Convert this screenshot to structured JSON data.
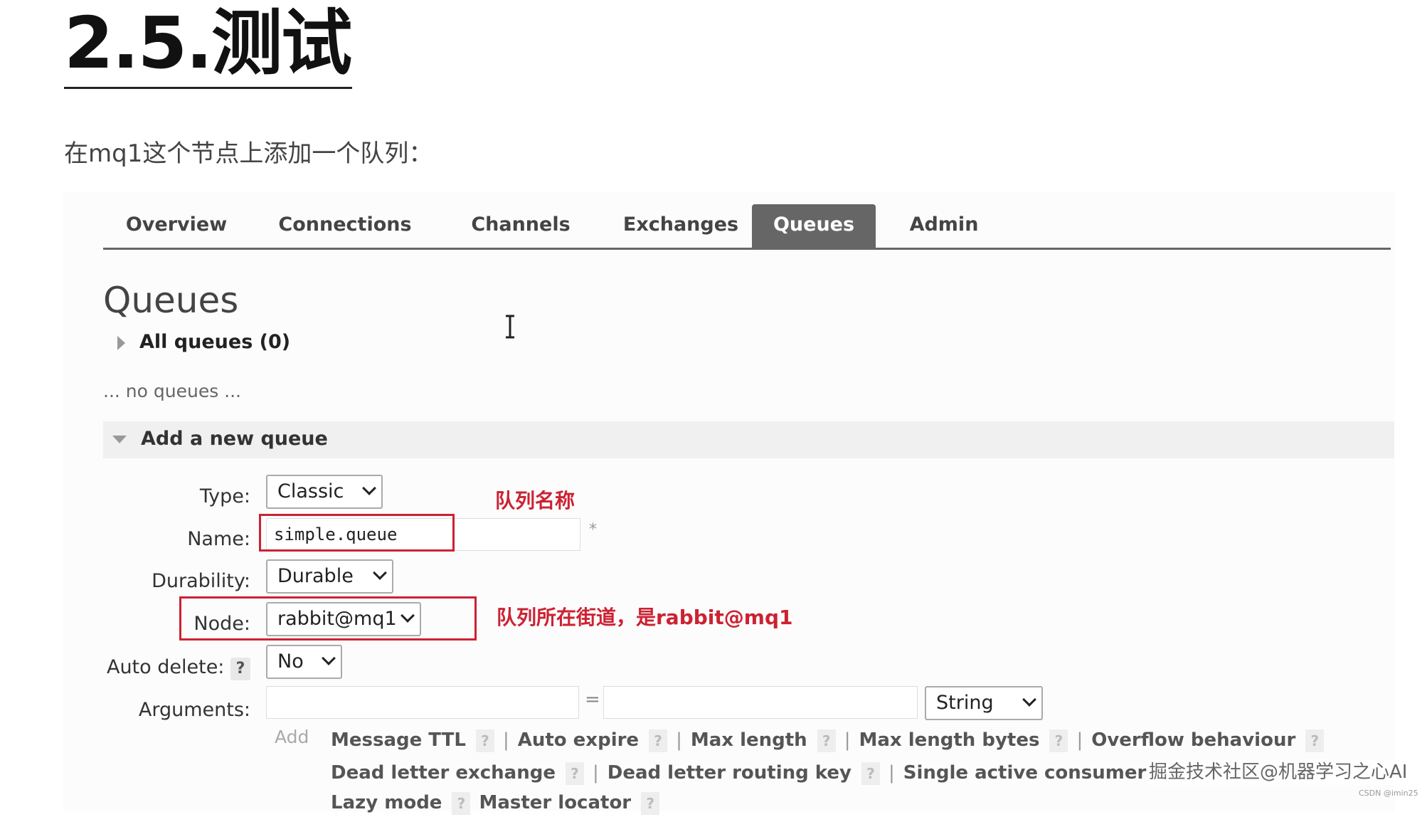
{
  "doc": {
    "title": "2.5.测试",
    "desc": "在mq1这个节点上添加一个队列："
  },
  "nav": {
    "tabs": [
      "Overview",
      "Connections",
      "Channels",
      "Exchanges",
      "Queues",
      "Admin"
    ],
    "active": "Queues"
  },
  "queues": {
    "heading": "Queues",
    "all_queues": "All queues (0)",
    "empty_text": "... no queues ...",
    "add_title": "Add a new queue"
  },
  "form": {
    "type_label": "Type:",
    "type_value": "Classic",
    "name_label": "Name:",
    "name_value": "simple.queue",
    "required_mark": "*",
    "durability_label": "Durability:",
    "durability_value": "Durable",
    "node_label": "Node:",
    "node_value": "rabbit@mq1",
    "auto_delete_label": "Auto delete:",
    "auto_delete_help": "?",
    "auto_delete_value": "No",
    "arguments_label": "Arguments:",
    "equals": "=",
    "arg_type_value": "String",
    "add_label": "Add"
  },
  "argument_options": {
    "row1": [
      "Message TTL",
      "Auto expire",
      "Max length",
      "Max length bytes",
      "Overflow behaviour"
    ],
    "row2": [
      "Dead letter exchange",
      "Dead letter routing key",
      "Single active consumer"
    ],
    "row3_partial": [
      "Lazy mode",
      "Master locator"
    ],
    "help": "?",
    "separator": "|"
  },
  "annotations": {
    "name_note": "队列名称",
    "node_note": "队列所在街道，是rabbit@mq1",
    "highlight_color": "#cc2233"
  },
  "watermark": {
    "main": "掘金技术社区@机器学习之心AI",
    "small": "CSDN @imin25"
  }
}
